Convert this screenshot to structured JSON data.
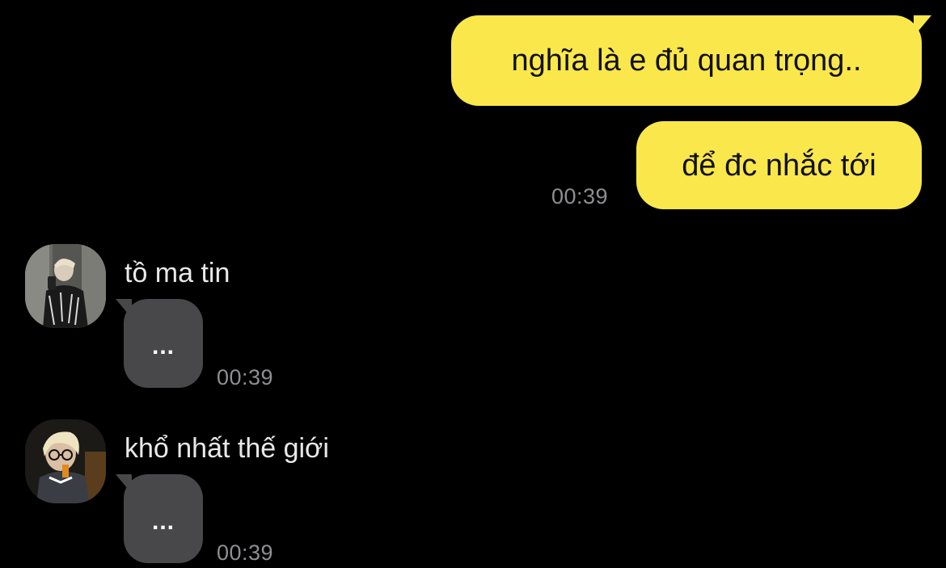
{
  "messages_out": [
    {
      "text": "nghĩa là e đủ quan trọng.."
    },
    {
      "text": "để đc nhắc tới"
    }
  ],
  "time_out": "00:39",
  "incoming": [
    {
      "sender": "tồ ma tin",
      "text": "...",
      "time": "00:39"
    },
    {
      "sender": "khổ nhất thế giới",
      "text": "...",
      "time": "00:39"
    }
  ],
  "colors": {
    "background": "#000000",
    "outgoing_bubble": "#FAE74B",
    "incoming_bubble": "#48484A",
    "timestamp": "#8E8E93"
  },
  "icons": {
    "avatar_1": "profile-photo",
    "avatar_2": "profile-photo"
  }
}
